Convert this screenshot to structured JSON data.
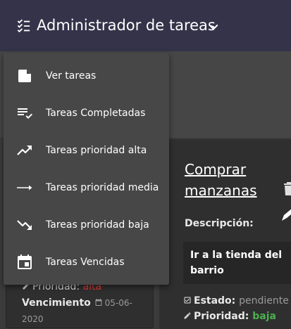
{
  "header": {
    "title": "Administrador de tareas",
    "menu_icon": "checklist-icon",
    "chevron_icon": "chevron-down-icon"
  },
  "menu": {
    "items": [
      {
        "label": "Ver tareas",
        "icon": "note-icon"
      },
      {
        "label": "Tareas Completadas",
        "icon": "playlist-check-icon"
      },
      {
        "label": "Tareas prioridad alta",
        "icon": "trending-up-icon"
      },
      {
        "label": "Tareas prioridad media",
        "icon": "arrow-right-icon"
      },
      {
        "label": "Tareas prioridad baja",
        "icon": "trending-down-icon"
      },
      {
        "label": "Tareas Vencidas",
        "icon": "calendar-icon"
      }
    ]
  },
  "card_left": {
    "priority_label": "Prioridad:",
    "priority_value": "alta",
    "due_label": "Vencimiento",
    "due_date": "05-06-",
    "due_year": "2020"
  },
  "card_right": {
    "title": "Comprar manzanas",
    "description_label": "Descripción:",
    "description_text": "Ir a la tienda del barrio",
    "status_label": "Estado:",
    "status_value": "pendiente",
    "priority_label": "Prioridad:",
    "priority_value": "baja"
  },
  "colors": {
    "header_bg": "#353349",
    "menu_bg": "#474747",
    "priority_high": "#e53935",
    "priority_low": "#4caf50"
  }
}
